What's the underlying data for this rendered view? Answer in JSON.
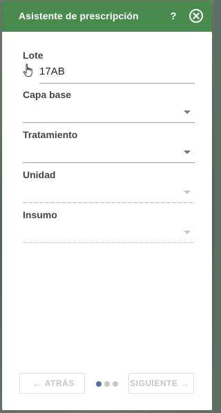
{
  "header": {
    "title": "Asistente de prescripción",
    "help_label": "?",
    "accent_color": "#4a8a4e"
  },
  "form": {
    "lote": {
      "label": "Lote",
      "value": "17AB"
    },
    "capa_base": {
      "label": "Capa base",
      "value": ""
    },
    "tratamiento": {
      "label": "Tratamiento",
      "value": ""
    },
    "unidad": {
      "label": "Unidad",
      "value": ""
    },
    "insumo": {
      "label": "Insumo",
      "value": ""
    }
  },
  "footer": {
    "back_label": "ATRÁS",
    "next_label": "SIGUIENTE",
    "back_arrow": "←",
    "next_arrow": "→",
    "steps_total": 3,
    "step_current": 1,
    "active_dot_color": "#5b6fa7"
  },
  "icons": {
    "help": "question-mark-icon",
    "close": "close-circle-icon",
    "cursor": "hand-pointer-icon",
    "dropdown": "chevron-down-icon"
  }
}
